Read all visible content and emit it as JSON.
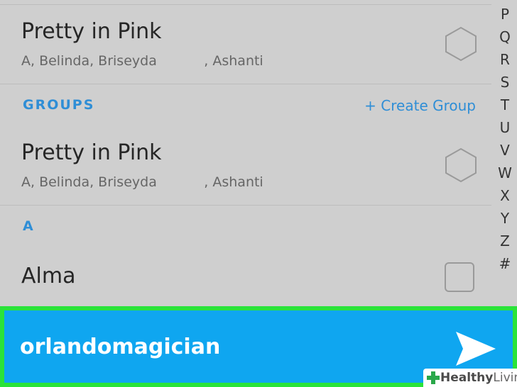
{
  "contacts_top": {
    "title": "Pretty in Pink",
    "members": "A, Belinda, Briseyda           , Ashanti"
  },
  "groups_section": {
    "label": "GROUPS",
    "create_label": "+ Create Group"
  },
  "group_item": {
    "title": "Pretty in Pink",
    "members": "A, Belinda, Briseyda           , Ashanti"
  },
  "section_a": {
    "label": "A"
  },
  "contact_alma": {
    "name": "Alma"
  },
  "index_letters": [
    "P",
    "Q",
    "R",
    "S",
    "T",
    "U",
    "V",
    "W",
    "X",
    "Y",
    "Z",
    "#"
  ],
  "send_bar": {
    "recipient": "orlandomagician"
  },
  "watermark": {
    "brand_strong": "Healthy",
    "brand_light": "Living"
  },
  "colors": {
    "accent": "#2f8ed6",
    "send_bar": "#0fa6f0",
    "highlight": "#2ae33a"
  }
}
